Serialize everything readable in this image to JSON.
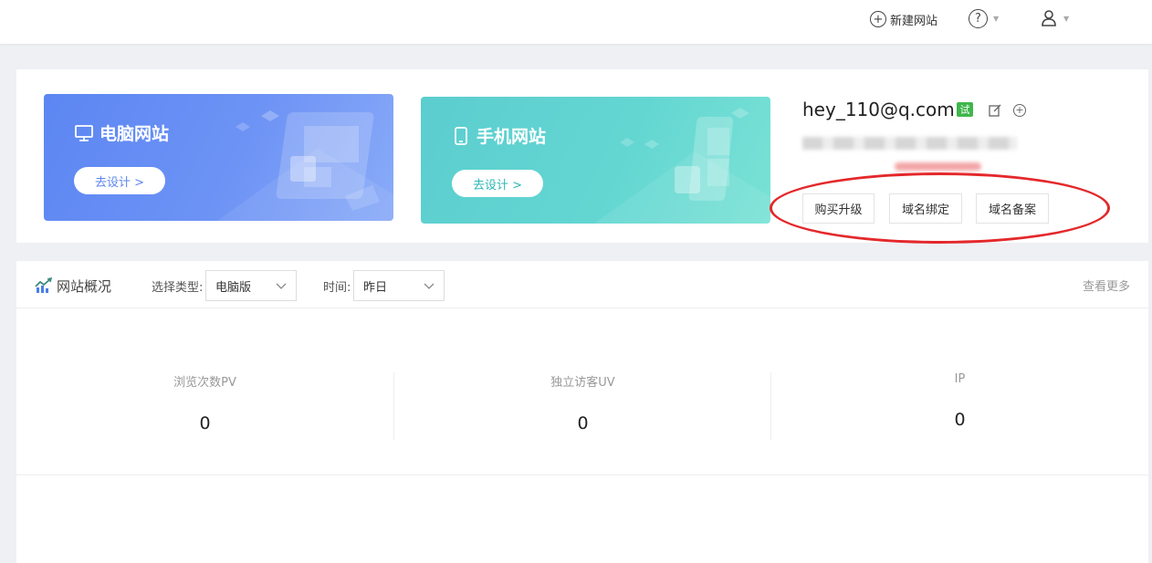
{
  "topbar": {
    "new_site_label": "新建网站",
    "help_icon": "question-circle-icon",
    "user_icon": "user-icon"
  },
  "banners": {
    "pc": {
      "title": "电脑网站",
      "button": "去设计 >",
      "icon": "monitor-icon"
    },
    "mobile": {
      "title": "手机网站",
      "button": "去设计 >",
      "icon": "phone-icon"
    }
  },
  "account": {
    "email": "hey_110@q.com",
    "badge": "试",
    "actions": [
      "购买升级",
      "域名绑定",
      "域名备案"
    ]
  },
  "overview": {
    "title": "网站概况",
    "type_label": "选择类型:",
    "type_value": "电脑版",
    "time_label": "时间:",
    "time_value": "昨日",
    "more": "查看更多",
    "stats": [
      {
        "label": "浏览次数PV",
        "value": "0"
      },
      {
        "label": "独立访客UV",
        "value": "0"
      },
      {
        "label": "IP",
        "value": "0"
      }
    ]
  },
  "colors": {
    "pc_banner": "#6a90f4",
    "mobile_banner": "#62d4d1",
    "trial_badge": "#3fb64b",
    "annotation": "#e4282b"
  }
}
